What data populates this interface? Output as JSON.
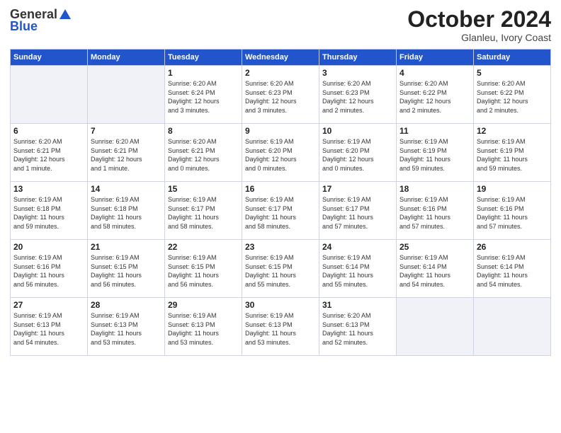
{
  "header": {
    "logo_general": "General",
    "logo_blue": "Blue",
    "title": "October 2024",
    "subtitle": "Glanleu, Ivory Coast"
  },
  "days_of_week": [
    "Sunday",
    "Monday",
    "Tuesday",
    "Wednesday",
    "Thursday",
    "Friday",
    "Saturday"
  ],
  "weeks": [
    [
      {
        "day": "",
        "info": ""
      },
      {
        "day": "",
        "info": ""
      },
      {
        "day": "1",
        "info": "Sunrise: 6:20 AM\nSunset: 6:24 PM\nDaylight: 12 hours\nand 3 minutes."
      },
      {
        "day": "2",
        "info": "Sunrise: 6:20 AM\nSunset: 6:23 PM\nDaylight: 12 hours\nand 3 minutes."
      },
      {
        "day": "3",
        "info": "Sunrise: 6:20 AM\nSunset: 6:23 PM\nDaylight: 12 hours\nand 2 minutes."
      },
      {
        "day": "4",
        "info": "Sunrise: 6:20 AM\nSunset: 6:22 PM\nDaylight: 12 hours\nand 2 minutes."
      },
      {
        "day": "5",
        "info": "Sunrise: 6:20 AM\nSunset: 6:22 PM\nDaylight: 12 hours\nand 2 minutes."
      }
    ],
    [
      {
        "day": "6",
        "info": "Sunrise: 6:20 AM\nSunset: 6:21 PM\nDaylight: 12 hours\nand 1 minute."
      },
      {
        "day": "7",
        "info": "Sunrise: 6:20 AM\nSunset: 6:21 PM\nDaylight: 12 hours\nand 1 minute."
      },
      {
        "day": "8",
        "info": "Sunrise: 6:20 AM\nSunset: 6:21 PM\nDaylight: 12 hours\nand 0 minutes."
      },
      {
        "day": "9",
        "info": "Sunrise: 6:19 AM\nSunset: 6:20 PM\nDaylight: 12 hours\nand 0 minutes."
      },
      {
        "day": "10",
        "info": "Sunrise: 6:19 AM\nSunset: 6:20 PM\nDaylight: 12 hours\nand 0 minutes."
      },
      {
        "day": "11",
        "info": "Sunrise: 6:19 AM\nSunset: 6:19 PM\nDaylight: 11 hours\nand 59 minutes."
      },
      {
        "day": "12",
        "info": "Sunrise: 6:19 AM\nSunset: 6:19 PM\nDaylight: 11 hours\nand 59 minutes."
      }
    ],
    [
      {
        "day": "13",
        "info": "Sunrise: 6:19 AM\nSunset: 6:18 PM\nDaylight: 11 hours\nand 59 minutes."
      },
      {
        "day": "14",
        "info": "Sunrise: 6:19 AM\nSunset: 6:18 PM\nDaylight: 11 hours\nand 58 minutes."
      },
      {
        "day": "15",
        "info": "Sunrise: 6:19 AM\nSunset: 6:17 PM\nDaylight: 11 hours\nand 58 minutes."
      },
      {
        "day": "16",
        "info": "Sunrise: 6:19 AM\nSunset: 6:17 PM\nDaylight: 11 hours\nand 58 minutes."
      },
      {
        "day": "17",
        "info": "Sunrise: 6:19 AM\nSunset: 6:17 PM\nDaylight: 11 hours\nand 57 minutes."
      },
      {
        "day": "18",
        "info": "Sunrise: 6:19 AM\nSunset: 6:16 PM\nDaylight: 11 hours\nand 57 minutes."
      },
      {
        "day": "19",
        "info": "Sunrise: 6:19 AM\nSunset: 6:16 PM\nDaylight: 11 hours\nand 57 minutes."
      }
    ],
    [
      {
        "day": "20",
        "info": "Sunrise: 6:19 AM\nSunset: 6:16 PM\nDaylight: 11 hours\nand 56 minutes."
      },
      {
        "day": "21",
        "info": "Sunrise: 6:19 AM\nSunset: 6:15 PM\nDaylight: 11 hours\nand 56 minutes."
      },
      {
        "day": "22",
        "info": "Sunrise: 6:19 AM\nSunset: 6:15 PM\nDaylight: 11 hours\nand 56 minutes."
      },
      {
        "day": "23",
        "info": "Sunrise: 6:19 AM\nSunset: 6:15 PM\nDaylight: 11 hours\nand 55 minutes."
      },
      {
        "day": "24",
        "info": "Sunrise: 6:19 AM\nSunset: 6:14 PM\nDaylight: 11 hours\nand 55 minutes."
      },
      {
        "day": "25",
        "info": "Sunrise: 6:19 AM\nSunset: 6:14 PM\nDaylight: 11 hours\nand 54 minutes."
      },
      {
        "day": "26",
        "info": "Sunrise: 6:19 AM\nSunset: 6:14 PM\nDaylight: 11 hours\nand 54 minutes."
      }
    ],
    [
      {
        "day": "27",
        "info": "Sunrise: 6:19 AM\nSunset: 6:13 PM\nDaylight: 11 hours\nand 54 minutes."
      },
      {
        "day": "28",
        "info": "Sunrise: 6:19 AM\nSunset: 6:13 PM\nDaylight: 11 hours\nand 53 minutes."
      },
      {
        "day": "29",
        "info": "Sunrise: 6:19 AM\nSunset: 6:13 PM\nDaylight: 11 hours\nand 53 minutes."
      },
      {
        "day": "30",
        "info": "Sunrise: 6:19 AM\nSunset: 6:13 PM\nDaylight: 11 hours\nand 53 minutes."
      },
      {
        "day": "31",
        "info": "Sunrise: 6:20 AM\nSunset: 6:13 PM\nDaylight: 11 hours\nand 52 minutes."
      },
      {
        "day": "",
        "info": ""
      },
      {
        "day": "",
        "info": ""
      }
    ]
  ]
}
